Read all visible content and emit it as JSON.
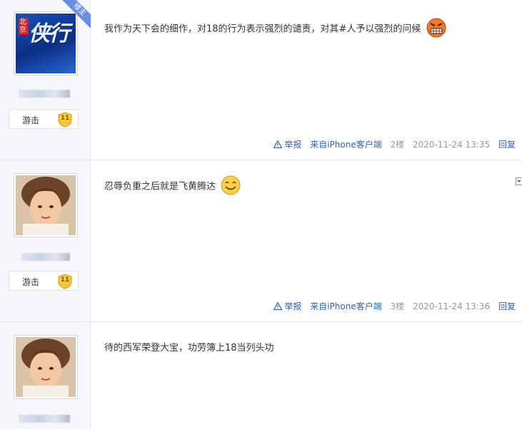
{
  "posts": [
    {
      "badge_label": "游击",
      "level": "11",
      "content": "我作为天下会的细作，对18的行为表示强烈的谴责，对其#人予以强烈的问候",
      "emoji": "angry-face-icon",
      "report": "举报",
      "source": "来自iPhone客户端",
      "floor": "2楼",
      "time": "2020-11-24 13:35",
      "reply": "回复",
      "ribbon": "楼主",
      "avatar_text_top": "北京",
      "avatar_text_main": "侠行"
    },
    {
      "badge_label": "游击",
      "level": "11",
      "content": "忍辱负重之后就是飞黄腾达",
      "emoji": "smile-face-icon",
      "report": "举报",
      "source": "来自iPhone客户端",
      "floor": "3楼",
      "time": "2020-11-24 13:36",
      "reply": "回复"
    },
    {
      "content": "待的西军荣登大宝，功劳簿上18当列头功"
    }
  ],
  "colors": {
    "link": "#2d64b3",
    "sidebar": "#f6f7fb",
    "ribbon": "#6d8ee0"
  }
}
